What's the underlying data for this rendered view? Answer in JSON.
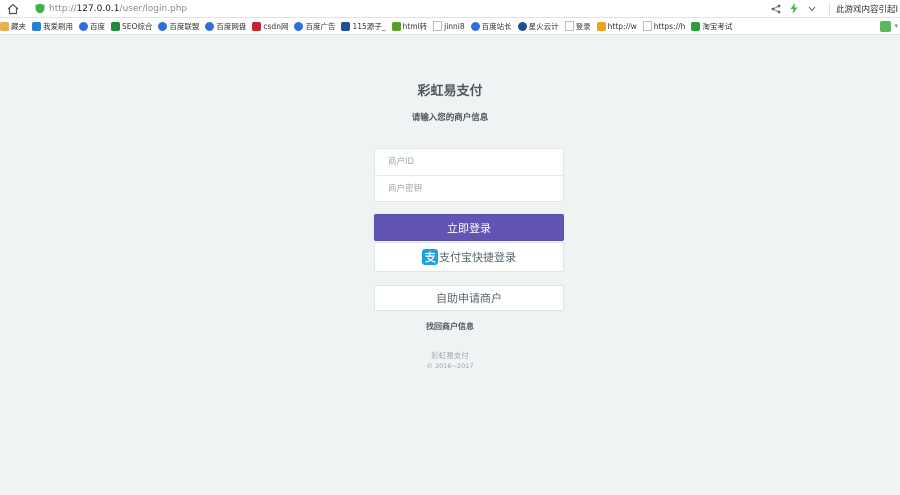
{
  "browser": {
    "url_prefix": "http://",
    "url_host": "127.0.0.1",
    "url_path": "/user/login.php",
    "search_text": "此游戏内容引起I"
  },
  "bookmarks": [
    {
      "label": "藏夹",
      "icon": "folder-icon",
      "color": "#f0ad4e"
    },
    {
      "label": "我爱刷用",
      "icon": "a-icon",
      "color": "#2b7fd1"
    },
    {
      "label": "百度",
      "icon": "baidu-paw-icon",
      "color": "#2f6fdb"
    },
    {
      "label": "SEO综合",
      "icon": "seo-icon",
      "color": "#1e8a3a"
    },
    {
      "label": "百度联盟",
      "icon": "baidu-paw-icon",
      "color": "#2f6fdb"
    },
    {
      "label": "百度网盘",
      "icon": "cloud-icon",
      "color": "#2f6fdb"
    },
    {
      "label": "csdn网",
      "icon": "csdn-icon",
      "color": "#c9252d"
    },
    {
      "label": "百度广告",
      "icon": "baidu-paw-icon",
      "color": "#2f6fdb"
    },
    {
      "label": "115源子_",
      "icon": "five-icon",
      "color": "#1e4f9c"
    },
    {
      "label": "html转",
      "icon": "check-icon",
      "color": "#5a9e2a"
    },
    {
      "label": "jinni8",
      "icon": "page-icon",
      "color": "#bbbbbb"
    },
    {
      "label": "百度站长",
      "icon": "baidu-paw-icon",
      "color": "#2f6fdb"
    },
    {
      "label": "星火云计",
      "icon": "eye-icon",
      "color": "#1f4f8f"
    },
    {
      "label": "登录",
      "icon": "page-icon",
      "color": "#bbbbbb"
    },
    {
      "label": "http://w",
      "icon": "flame-icon",
      "color": "#f0a020"
    },
    {
      "label": "https://h",
      "icon": "page-icon",
      "color": "#bbbbbb"
    },
    {
      "label": "淘宝考试",
      "icon": "taobao-icon",
      "color": "#2d9d3a"
    }
  ],
  "page": {
    "brand": "彩虹易支付",
    "subtitle": "请输入您的商户信息",
    "merchant_id_placeholder": "商户ID",
    "merchant_key_placeholder": "商户密钥",
    "login_button": "立即登录",
    "alipay_button": "支付宝快捷登录",
    "apply_button": "自助申请商户",
    "find_link": "找回商户信息",
    "footer_name": "彩虹易支付",
    "footer_copy": "© 2016~2017"
  },
  "colors": {
    "primary": "#6254b2",
    "alipay": "#1ba0e1",
    "background": "#f0f3f4"
  }
}
